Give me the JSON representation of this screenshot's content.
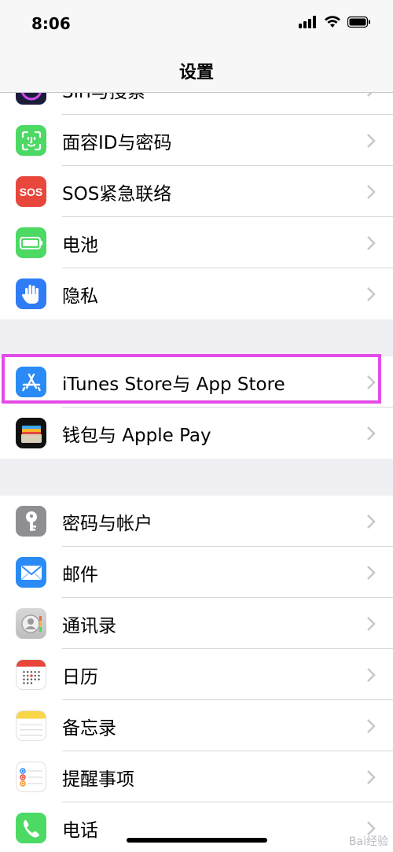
{
  "status_bar": {
    "time": "8:06",
    "signal_icon": "cellular-signal-icon",
    "wifi_icon": "wifi-icon",
    "battery_icon": "battery-icon"
  },
  "nav": {
    "title": "设置"
  },
  "groups": [
    {
      "items": [
        {
          "label": "Siri与搜索",
          "icon": "siri-icon",
          "color": "#1c1c3a"
        },
        {
          "label": "面容ID与密码",
          "icon": "face-id-icon",
          "color": "#4cd964"
        },
        {
          "label": "SOS紧急联络",
          "icon": "sos-icon",
          "color": "#e8473c"
        },
        {
          "label": "电池",
          "icon": "battery-app-icon",
          "color": "#4cd964"
        },
        {
          "label": "隐私",
          "icon": "hand-icon",
          "color": "#2f7cf6"
        }
      ]
    },
    {
      "items": [
        {
          "label": "iTunes Store与 App Store",
          "icon": "app-store-icon",
          "color": "#2b8bf6"
        },
        {
          "label": "钱包与 Apple Pay",
          "icon": "wallet-icon",
          "color": "#111111"
        }
      ]
    },
    {
      "items": [
        {
          "label": "密码与帐户",
          "icon": "key-icon",
          "color": "#8e8e93"
        },
        {
          "label": "邮件",
          "icon": "mail-icon",
          "color": "#2b8bf6"
        },
        {
          "label": "通讯录",
          "icon": "contacts-icon",
          "color": "#c8c8c8"
        },
        {
          "label": "日历",
          "icon": "calendar-icon",
          "color": "#ffffff"
        },
        {
          "label": "备忘录",
          "icon": "notes-icon",
          "color": "#ffffff"
        },
        {
          "label": "提醒事项",
          "icon": "reminders-icon",
          "color": "#ffffff"
        },
        {
          "label": "电话",
          "icon": "phone-icon",
          "color": "#4cd964"
        }
      ]
    }
  ],
  "highlight_color": "#e34be8",
  "watermark": "Bai经验"
}
